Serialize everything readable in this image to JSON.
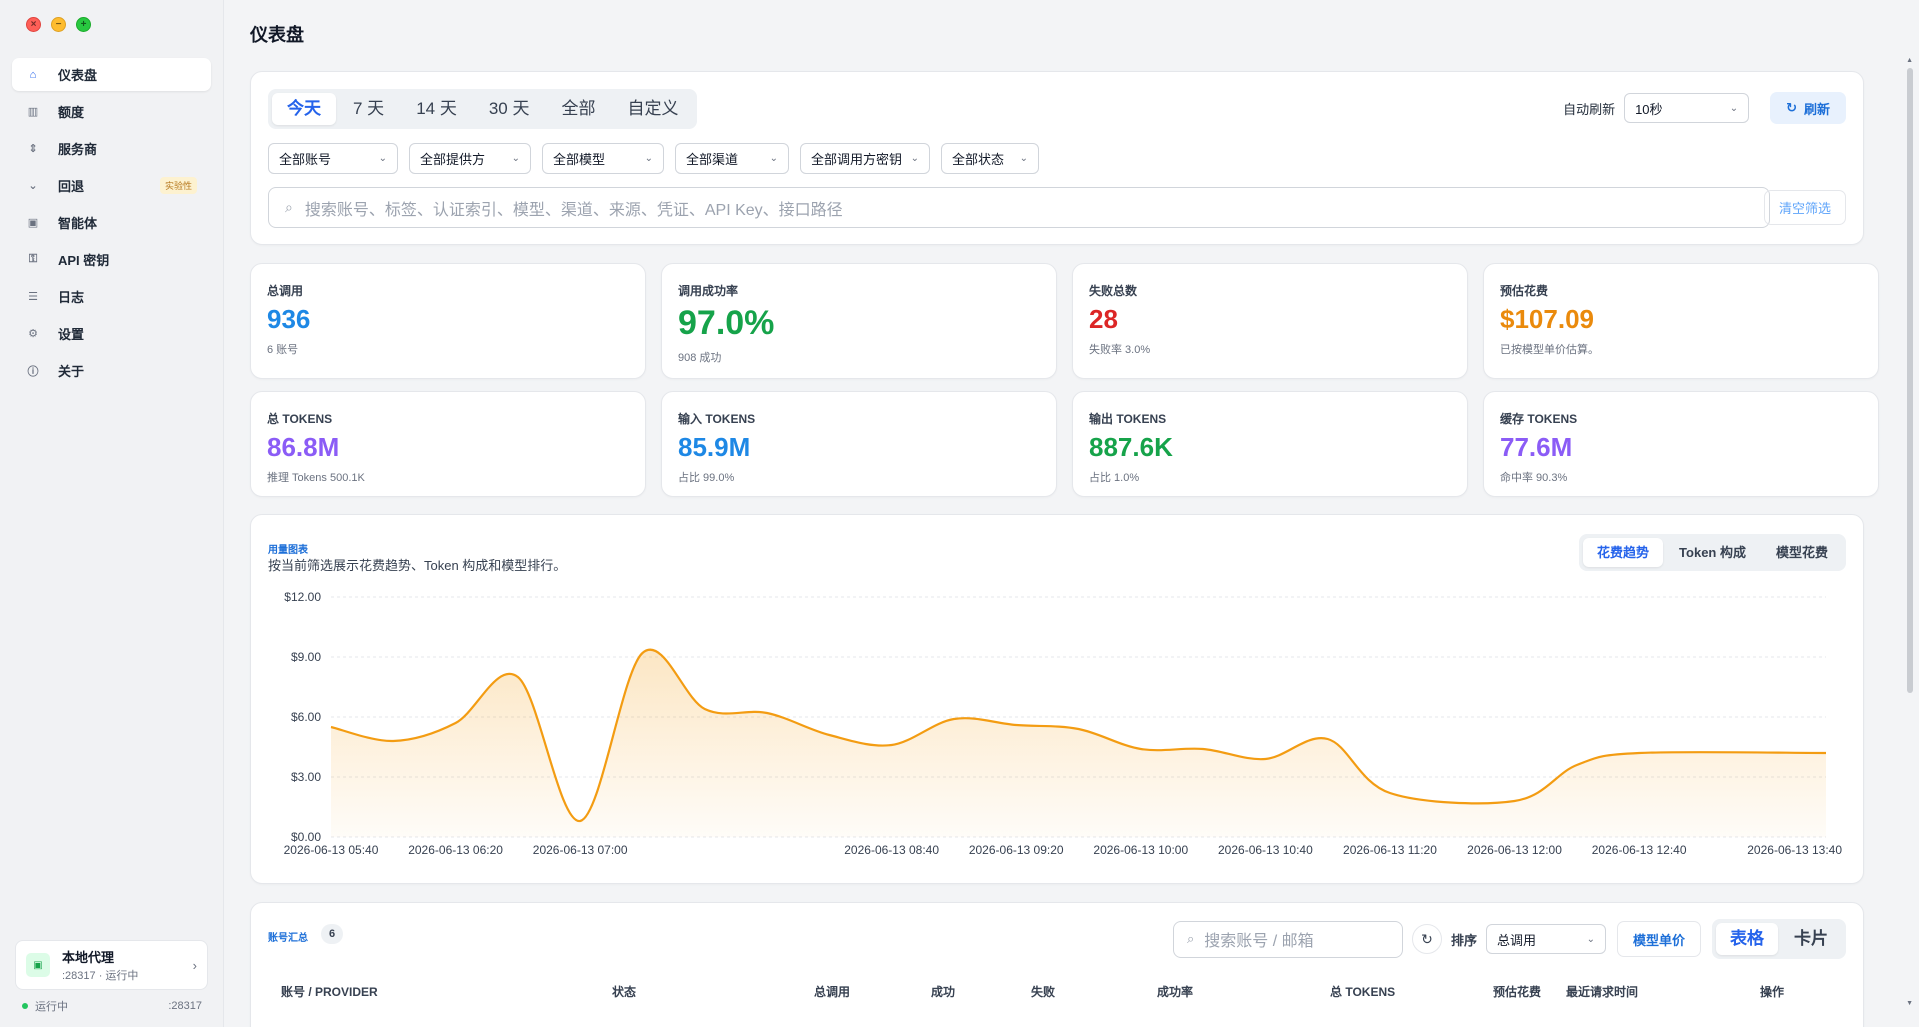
{
  "sidebar": {
    "items": [
      {
        "label": "仪表盘",
        "icon": "home-icon",
        "glyph": "⌂",
        "active": true
      },
      {
        "label": "额度",
        "icon": "grid-icon",
        "glyph": "▥"
      },
      {
        "label": "服务商",
        "icon": "sort-icon",
        "glyph": "⇕"
      },
      {
        "label": "回退",
        "icon": "chevron-down-icon",
        "glyph": "⌄",
        "badge": "实验性"
      },
      {
        "label": "智能体",
        "icon": "agent-icon",
        "glyph": "▣"
      },
      {
        "label": "API 密钥",
        "icon": "key-icon",
        "glyph": "⚿"
      },
      {
        "label": "日志",
        "icon": "list-icon",
        "glyph": "☰"
      },
      {
        "label": "设置",
        "icon": "gear-icon",
        "glyph": "⚙"
      },
      {
        "label": "关于",
        "icon": "info-icon",
        "glyph": "ⓘ"
      }
    ],
    "proxy": {
      "title": "本地代理",
      "subtitle": ":28317 · 运行中"
    },
    "footer": {
      "status": "运行中",
      "port": ":28317"
    }
  },
  "page": {
    "title": "仪表盘"
  },
  "filters": {
    "ranges": [
      "今天",
      "7 天",
      "14 天",
      "30 天",
      "全部",
      "自定义"
    ],
    "active_range": 0,
    "auto_refresh_label": "自动刷新",
    "auto_refresh_value": "10秒",
    "refresh_label": "刷新",
    "selects": [
      "全部账号",
      "全部提供方",
      "全部模型",
      "全部渠道",
      "全部调用方密钥",
      "全部状态"
    ],
    "search_placeholder": "搜索账号、标签、认证索引、模型、渠道、来源、凭证、API Key、接口路径",
    "clear_label": "清空筛选"
  },
  "stats": [
    {
      "label": "总调用",
      "value": "936",
      "sub": "6 账号",
      "color": "#1e88e5"
    },
    {
      "label": "调用成功率",
      "value": "97.0%",
      "sub": "908 成功",
      "color": "#16a34a",
      "big": true
    },
    {
      "label": "失败总数",
      "value": "28",
      "sub": "失败率 3.0%",
      "color": "#dc2626"
    },
    {
      "label": "预估花费",
      "value": "$107.09",
      "sub": "已按模型单价估算。",
      "color": "#ea8a0c"
    },
    {
      "label": "总 TOKENS",
      "value": "86.8M",
      "sub": "推理 Tokens 500.1K",
      "color": "#8b5cf6"
    },
    {
      "label": "输入 TOKENS",
      "value": "85.9M",
      "sub": "占比 99.0%",
      "color": "#1e88e5"
    },
    {
      "label": "输出 TOKENS",
      "value": "887.6K",
      "sub": "占比 1.0%",
      "color": "#16a34a"
    },
    {
      "label": "缓存 TOKENS",
      "value": "77.6M",
      "sub": "命中率 90.3%",
      "color": "#8b5cf6"
    }
  ],
  "chart": {
    "section_label": "用量图表",
    "description": "按当前筛选展示花费趋势、Token 构成和模型排行。",
    "tabs": [
      "花费趋势",
      "Token 构成",
      "模型花费"
    ],
    "active_tab": 0
  },
  "chart_data": {
    "type": "area",
    "x": [
      "2026-06-13 05:40",
      "2026-06-13 06:00",
      "2026-06-13 06:20",
      "2026-06-13 06:40",
      "2026-06-13 07:00",
      "2026-06-13 07:20",
      "2026-06-13 07:40",
      "2026-06-13 08:00",
      "2026-06-13 08:20",
      "2026-06-13 08:40",
      "2026-06-13 09:00",
      "2026-06-13 09:20",
      "2026-06-13 09:40",
      "2026-06-13 10:00",
      "2026-06-13 10:20",
      "2026-06-13 10:40",
      "2026-06-13 11:00",
      "2026-06-13 11:20",
      "2026-06-13 11:40",
      "2026-06-13 12:00",
      "2026-06-13 12:20",
      "2026-06-13 12:40",
      "2026-06-13 13:00",
      "2026-06-13 13:20",
      "2026-06-13 13:40"
    ],
    "xticks": [
      "2026-06-13 05:40",
      "2026-06-13 06:20",
      "2026-06-13 07:00",
      "2026-06-13 08:40",
      "2026-06-13 09:20",
      "2026-06-13 10:00",
      "2026-06-13 10:40",
      "2026-06-13 11:20",
      "2026-06-13 12:00",
      "2026-06-13 12:40",
      "2026-06-13 13:40"
    ],
    "values": [
      5.5,
      4.8,
      5.7,
      8.0,
      0.8,
      9.2,
      6.4,
      6.2,
      5.1,
      4.6,
      5.9,
      5.6,
      5.4,
      4.4,
      4.4,
      3.9,
      4.9,
      2.2,
      1.8,
      3.6,
      4.2,
      4.2
    ],
    "value_x_index": [
      0,
      1,
      2,
      3,
      4,
      5,
      6,
      7,
      8,
      9,
      10,
      11,
      12,
      13,
      14,
      15,
      16,
      17,
      19,
      20,
      21,
      24
    ],
    "yticks": [
      "$0.00",
      "$3.00",
      "$6.00",
      "$9.00",
      "$12.00"
    ],
    "ylim": [
      0,
      12
    ],
    "color": "#f39c12",
    "grid": true
  },
  "table": {
    "title": "账号汇总",
    "count": "6",
    "search_placeholder": "搜索账号 / 邮箱",
    "sort_label": "排序",
    "sort_value": "总调用",
    "model_price_label": "模型单价",
    "views": [
      "表格",
      "卡片"
    ],
    "active_view": 0,
    "columns": [
      "账号 / PROVIDER",
      "状态",
      "总调用",
      "成功",
      "失败",
      "成功率",
      "总 TOKENS",
      "预估花费",
      "最近请求时间",
      "操作"
    ]
  }
}
